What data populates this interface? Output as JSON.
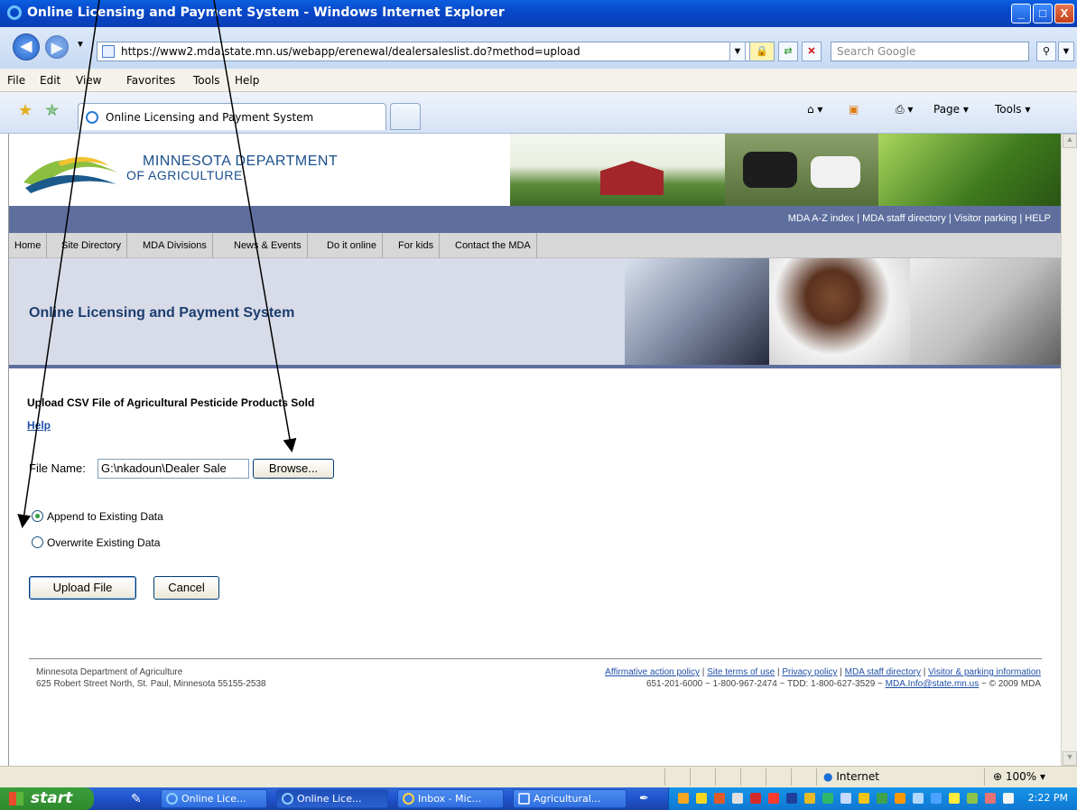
{
  "window": {
    "title": "Online Licensing and Payment System - Windows Internet Explorer",
    "minimize": "_",
    "maximize": "□",
    "close": "X"
  },
  "address": {
    "url": "https://www2.mda.state.mn.us/webapp/erenewal/dealersaleslist.do?method=upload",
    "search_placeholder": "Search Google"
  },
  "menu": [
    "File",
    "Edit",
    "View",
    "Favorites",
    "Tools",
    "Help"
  ],
  "tab": {
    "title": "Online Licensing and Payment System"
  },
  "commands": {
    "page": "Page",
    "tools": "Tools"
  },
  "site": {
    "logo_line1": "MINNESOTA DEPARTMENT",
    "logo_line2": "OF AGRICULTURE",
    "top_links": "MDA A-Z index | MDA staff directory | Visitor parking | HELP",
    "nav": [
      "Home",
      "Site Directory",
      "MDA Divisions",
      "News & Events",
      "Do it online",
      "For kids",
      "Contact the MDA"
    ],
    "hero_title": "Online Licensing and Payment System"
  },
  "form": {
    "heading": "Upload CSV File of Agricultural Pesticide Products Sold",
    "help": "Help",
    "file_label": "File Name:",
    "file_value": "G:\\nkadoun\\Dealer Sale",
    "browse": "Browse...",
    "radio_append": "Append to Existing Data",
    "radio_overwrite": "Overwrite Existing Data",
    "upload": "Upload File",
    "cancel": "Cancel"
  },
  "footer": {
    "left_line1": "Minnesota Department of Agriculture",
    "left_line2": "625 Robert Street North, St. Paul, Minnesota 55155-2538",
    "links": [
      "Affirmative action policy",
      "Site terms of use",
      "Privacy policy",
      "MDA staff directory",
      "Visitor & parking information"
    ],
    "phone": "651-201-6000 ~ 1-800-967-2474 ~ TDD: 1-800-627-3529 ~",
    "email": "MDA.Info@state.mn.us",
    "copyright": "~ © 2009 MDA"
  },
  "status": {
    "zone": "Internet",
    "zoom": "100%"
  },
  "taskbar": {
    "start": "start",
    "tasks": [
      "Online Lice...",
      "Online Lice...",
      "Inbox - Mic...",
      "Agricultural..."
    ],
    "clock": "2:22 PM"
  }
}
